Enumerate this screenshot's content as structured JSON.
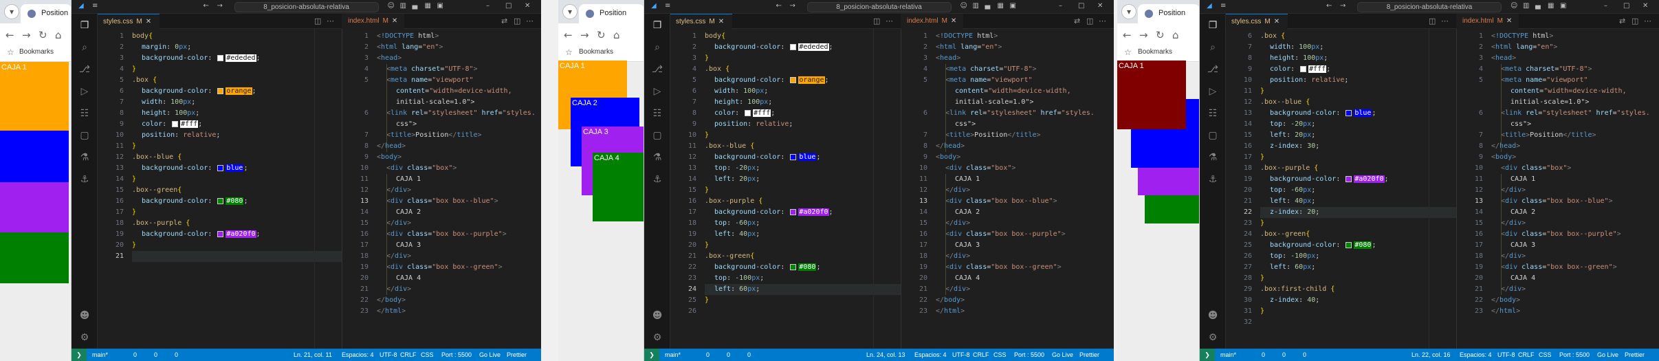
{
  "browser": {
    "tab_title": "Position",
    "bookmarks_label": "Bookmarks",
    "nav_icons": [
      "back-icon",
      "forward-icon",
      "reload-icon",
      "home-icon"
    ]
  },
  "vscode": {
    "search_text": "8_posicion-absoluta-relativa",
    "css_tab": "styles.css",
    "css_tab_mark": "M",
    "html_tab": "index.html",
    "html_tab_mark": "M",
    "branch": "main*",
    "errors": "0",
    "warnings": "0",
    "ports": "0",
    "spaces": "Espacios: 4",
    "encoding": "UTF-8",
    "eol": "CRLF",
    "lang": "CSS",
    "port": "Port : 5500",
    "golive": "Go Live",
    "prettier": "Prettier"
  },
  "html_lines": [
    "<!DOCTYPE html>",
    "<html lang=\"en\">",
    "<head>",
    "<meta charset=\"UTF-8\">",
    "<meta name=\"viewport\"",
    "content=\"width=device-width,",
    "initial-scale=1.0\">",
    "<link rel=\"stylesheet\" href=\"styles.",
    "css\">",
    "<title>Position</title>",
    "</head>",
    "<body>",
    "<div class=\"box\">",
    "CAJA 1",
    "</div>",
    "<div class=\"box box--blue\">",
    "CAJA 2",
    "</div>",
    "<div class=\"box box--purple\">",
    "CAJA 3",
    "</div>",
    "<div class=\"box box--green\">",
    "CAJA 4",
    "</div>",
    "</body>",
    "</html>"
  ],
  "panels": [
    {
      "cursor": "Ln. 21, col. 11",
      "boxes": [
        {
          "label": "CAJA 1",
          "color": "#ffa500"
        },
        {
          "label": "CAJA 2",
          "color": "#0000ff"
        },
        {
          "label": "CAJA 3",
          "color": "#a020f0"
        },
        {
          "label": "CAJA 4",
          "color": "#008000"
        }
      ],
      "css_line_numbers": [
        "1",
        "2",
        "3",
        "4",
        "5",
        "6",
        "7",
        "8",
        "9",
        "10",
        "11",
        "12",
        "13",
        "14",
        "15",
        "16",
        "17",
        "18",
        "19",
        "20",
        "21"
      ],
      "css_lines": [
        "body{",
        "margin: 0px;",
        "background-color: #ededed;",
        "}",
        ".box {",
        "background-color: orange;",
        "width: 100px;",
        "height: 100px;",
        "color: #fff;",
        "position: relative;",
        "}",
        ".box--blue {",
        "background-color: blue;",
        "}",
        ".box--green{",
        "background-color: #080;",
        "}",
        ".box--purple {",
        "background-color: #a020f0;",
        "}",
        ""
      ],
      "html_line_numbers": [
        "1",
        "2",
        "3",
        "4",
        "5",
        "",
        "",
        "6",
        "",
        "7",
        "8",
        "9",
        "10",
        "11",
        "12",
        "13",
        "14",
        "15",
        "16",
        "17",
        "18",
        "19",
        "20",
        "21",
        "22",
        "23",
        "24"
      ]
    },
    {
      "cursor": "Ln. 24, col. 13",
      "boxes": [
        {
          "label": "CAJA 1",
          "color": "#ffa500"
        },
        {
          "label": "CAJA 2",
          "color": "#0000ff"
        },
        {
          "label": "CAJA 3",
          "color": "#a020f0"
        },
        {
          "label": "CAJA 4",
          "color": "#008000"
        }
      ],
      "css_line_numbers": [
        "1",
        "2",
        "3",
        "4",
        "5",
        "6",
        "7",
        "8",
        "9",
        "10",
        "11",
        "12",
        "13",
        "14",
        "15",
        "16",
        "17",
        "18",
        "19",
        "20",
        "21",
        "22",
        "23",
        "24",
        "25",
        "26"
      ],
      "css_lines": [
        "body{",
        "background-color: #ededed;",
        "}",
        ".box {",
        "background-color: orange;",
        "width: 100px;",
        "height: 100px;",
        "color: #fff;",
        "position: relative;",
        "}",
        ".box--blue {",
        "background-color: blue;",
        "top: -20px;",
        "left: 20px;",
        "}",
        ".box--purple {",
        "background-color: #a020f0;",
        "top: -60px;",
        "left: 40px;",
        "}",
        ".box--green{",
        "background-color: #080;",
        "top: -100px;",
        "left: 60px;",
        "}",
        ""
      ],
      "html_line_numbers": [
        "1",
        "2",
        "3",
        "4",
        "5",
        "",
        "",
        "6",
        "",
        "7",
        "8",
        "9",
        "10",
        "11",
        "12",
        "13",
        "14",
        "15",
        "16",
        "17",
        "18",
        "19",
        "20",
        "21",
        "22",
        "23",
        "24"
      ]
    },
    {
      "cursor": "Ln. 22, col. 16",
      "boxes": [
        {
          "label": "CAJA 1",
          "color": "#800000"
        },
        {
          "label": "",
          "color": "#0000ff"
        },
        {
          "label": "",
          "color": "#a020f0"
        },
        {
          "label": "",
          "color": "#008000"
        }
      ],
      "css_line_numbers": [
        "6",
        "7",
        "8",
        "9",
        "10",
        "11",
        "12",
        "13",
        "14",
        "15",
        "16",
        "17",
        "18",
        "19",
        "20",
        "21",
        "22",
        "23",
        "24",
        "25",
        "26",
        "27",
        "28",
        "29",
        "30",
        "31",
        "32"
      ],
      "css_lines": [
        ".box {",
        "width: 100px;",
        "height: 100px;",
        "color: #fff;",
        "position: relative;",
        "}",
        ".box--blue {",
        "background-color: blue;",
        "top: -20px;",
        "left: 20px;",
        "z-index: 30;",
        "}",
        ".box--purple {",
        "background-color: #a020f0;",
        "top: -60px;",
        "left: 40px;",
        "z-index: 20;",
        "}",
        ".box--green{",
        "background-color: #080;",
        "top: -100px;",
        "left: 60px;",
        "}",
        ".box:first-child {",
        "z-index:40;",
        "}",
        ""
      ],
      "html_line_numbers": [
        "1",
        "2",
        "3",
        "4",
        "5",
        "",
        "",
        "6",
        "",
        "7",
        "8",
        "9",
        "10",
        "11",
        "12",
        "13",
        "14",
        "15",
        "16",
        "17",
        "18",
        "19",
        "20",
        "21",
        "22",
        "23"
      ]
    }
  ]
}
